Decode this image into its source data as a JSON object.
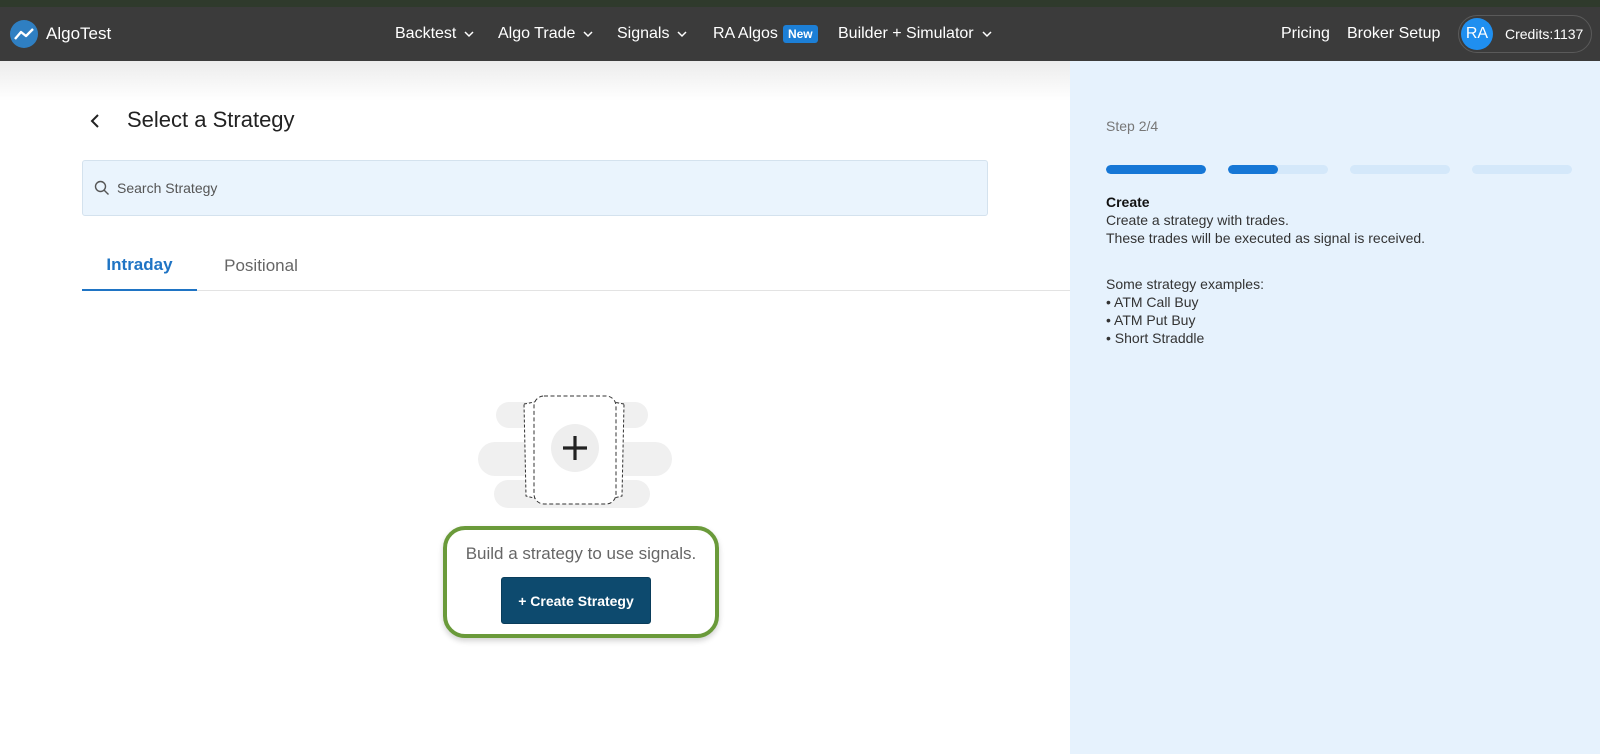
{
  "brand": {
    "name": "AlgoTest"
  },
  "nav": {
    "items": [
      {
        "label": "Backtest",
        "dropdown": true
      },
      {
        "label": "Algo Trade",
        "dropdown": true
      },
      {
        "label": "Signals",
        "dropdown": true
      },
      {
        "label": "RA Algos",
        "badge": "New"
      },
      {
        "label": "Builder + Simulator",
        "dropdown": true
      }
    ],
    "pricing": "Pricing",
    "broker_setup": "Broker Setup",
    "avatar_initials": "RA",
    "credits": "Credits:1137"
  },
  "page": {
    "title": "Select a Strategy",
    "search": {
      "placeholder": "Search Strategy",
      "value": ""
    },
    "tabs": [
      {
        "label": "Intraday",
        "active": true
      },
      {
        "label": "Positional",
        "active": false
      }
    ],
    "empty_state": {
      "message": "Build a strategy to use signals.",
      "button": "+ Create Strategy"
    }
  },
  "side_panel": {
    "step": "Step 2/4",
    "progress": [
      1.0,
      0.5,
      0.0,
      0.0
    ],
    "heading": "Create",
    "lines": [
      "Create a strategy with trades.",
      "These trades will be executed as signal is received."
    ],
    "examples_title": "Some strategy examples:",
    "examples": [
      "• ATM Call Buy",
      "• ATM Put Buy",
      "• Short Straddle"
    ]
  },
  "colors": {
    "navbar": "#3b3b3b",
    "accent": "#1f74c4",
    "button": "#0d4a6e",
    "highlight": "#6a9a3a",
    "side_bg": "#e6f2fd"
  }
}
